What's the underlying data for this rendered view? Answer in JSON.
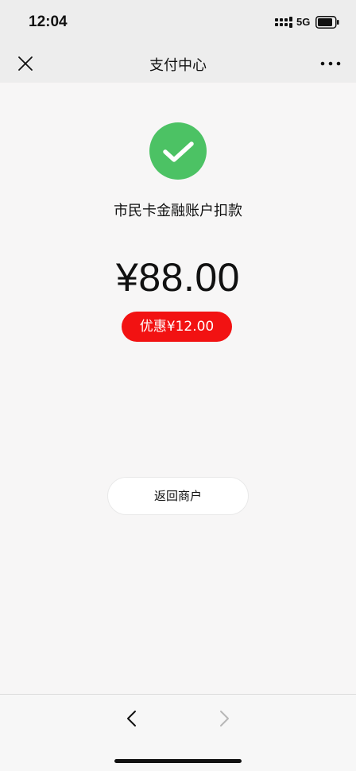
{
  "status_bar": {
    "time": "12:04",
    "network": "5G",
    "icons": [
      "signal-icon",
      "battery-icon"
    ]
  },
  "nav": {
    "title": "支付中心",
    "icons": [
      "close-icon",
      "more-icon"
    ]
  },
  "result": {
    "icon": "success-check-icon",
    "merchant": "市民卡金融账户扣款",
    "amount": "¥88.00",
    "discount": "优惠¥12.00"
  },
  "actions": {
    "return_label": "返回商户"
  },
  "bottom_nav": {
    "icons": [
      "back-icon",
      "forward-icon"
    ]
  },
  "colors": {
    "success_green": "#4cc264",
    "discount_red": "#f21212",
    "background": "#f7f6f6",
    "header_gray": "#ededed"
  }
}
